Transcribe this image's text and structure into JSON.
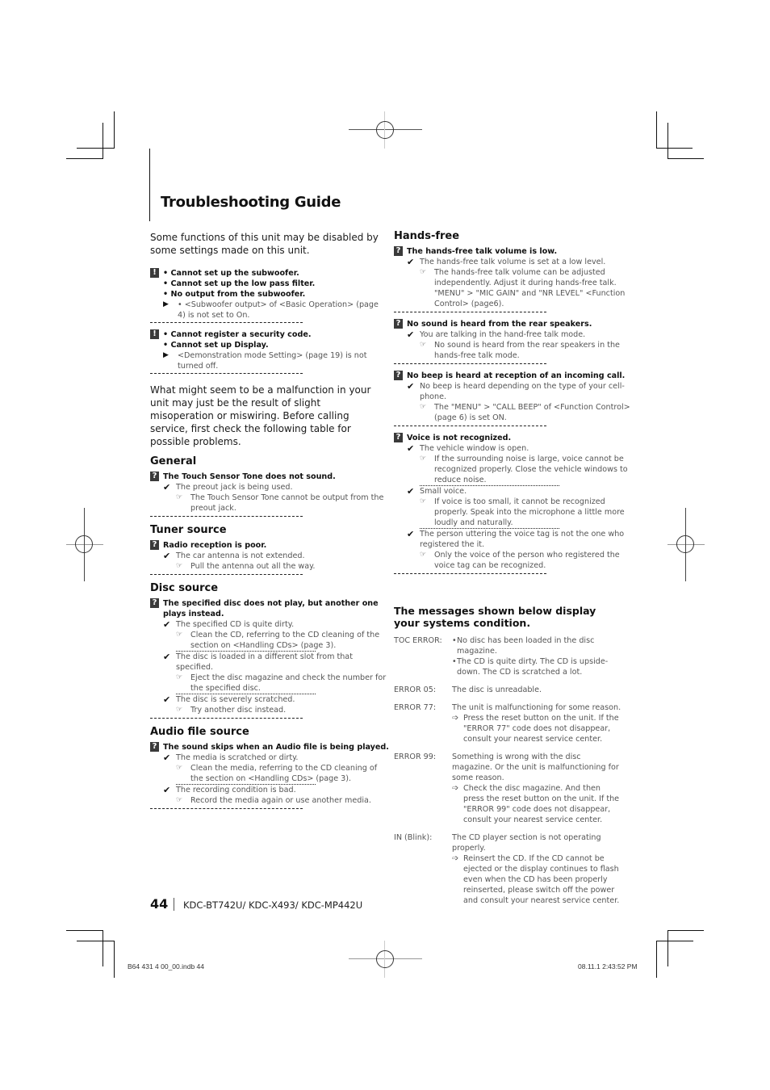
{
  "page": {
    "title": "Troubleshooting Guide",
    "page_number": "44",
    "model_line": "KDC-BT742U/ KDC-X493/ KDC-MP442U",
    "slug_file": "B64 431 4 00_00.indb   44",
    "slug_datetime": "08.11.1   2:43:52 PM"
  },
  "intro": "Some functions of this unit may be disabled by some settings made on this unit.",
  "notices": [
    {
      "icon": "exclamation-icon",
      "lines": [
        "• Cannot set up the subwoofer.",
        "• Cannot set up the low pass filter.",
        "• No output from the subwoofer."
      ],
      "note": "• <Subwoofer output> of <Basic Operation> (page 4) is not set to On."
    },
    {
      "icon": "exclamation-icon",
      "lines": [
        "• Cannot register a security code.",
        "• Cannot set up Display."
      ],
      "note": "<Demonstration mode Setting> (page 19) is not turned off."
    }
  ],
  "intro2": "What might seem to be a malfunction in your unit may just be the result of slight misoperation or miswiring. Before calling service, first check the following table for possible problems.",
  "sections_left": [
    {
      "heading": "General",
      "problems": [
        {
          "title": "The Touch Sensor Tone does not sound.",
          "causes": [
            {
              "cause": "The preout jack is being used.",
              "remedy": "The Touch Sensor Tone cannot be output from the preout jack."
            }
          ]
        }
      ]
    },
    {
      "heading": "Tuner source",
      "problems": [
        {
          "title": "Radio reception is poor.",
          "causes": [
            {
              "cause": "The car antenna is not extended.",
              "remedy": "Pull the antenna out all the way."
            }
          ]
        }
      ]
    },
    {
      "heading": "Disc source",
      "problems": [
        {
          "title": "The specified disc does not play, but another one plays instead.",
          "causes": [
            {
              "cause": "The specified CD is quite dirty.",
              "remedy": "Clean the CD, referring to the CD cleaning of the section on <Handling CDs> (page 3)."
            },
            {
              "cause": "The disc is loaded in a different slot from that specified.",
              "remedy": "Eject the disc magazine and check the number for the specified disc."
            },
            {
              "cause": "The disc is severely scratched.",
              "remedy": "Try another disc instead."
            }
          ]
        }
      ]
    },
    {
      "heading": "Audio file source",
      "problems": [
        {
          "title": "The sound skips when an Audio file is being played.",
          "causes": [
            {
              "cause": "The media is scratched or dirty.",
              "remedy": "Clean the media, referring to the CD cleaning of the section on <Handling CDs> (page 3)."
            },
            {
              "cause": "The recording condition is bad.",
              "remedy": "Record the media again or use another media."
            }
          ]
        }
      ]
    }
  ],
  "sections_right": [
    {
      "heading": "Hands-free",
      "problems": [
        {
          "title": "The hands-free talk volume is low.",
          "causes": [
            {
              "cause": "The hands-free talk volume is set at a low level.",
              "remedy": "The hands-free talk volume can be adjusted independently. Adjust it during hands-free talk. \"MENU\" > \"MIC GAIN\" and \"NR LEVEL\" <Function Control> (page6)."
            }
          ]
        },
        {
          "title": "No sound is heard from the rear speakers.",
          "causes": [
            {
              "cause": "You are talking in the hand-free talk mode.",
              "remedy": "No sound is heard from the rear speakers in the hands-free talk mode."
            }
          ]
        },
        {
          "title": "No beep is heard at reception of an incoming call.",
          "causes": [
            {
              "cause": "No beep is heard depending on the type of your cell-phone.",
              "remedy": "The \"MENU\" > \"CALL BEEP\" of <Function Control> (page 6) is set ON."
            }
          ]
        },
        {
          "title": "Voice is not recognized.",
          "causes": [
            {
              "cause": "The vehicle window is open.",
              "remedy": "If the surrounding noise is large, voice cannot be recognized properly. Close the vehicle windows to reduce noise."
            },
            {
              "cause": "Small voice.",
              "remedy": "If voice is too small, it cannot be recognized properly. Speak into the microphone a little more loudly and naturally."
            },
            {
              "cause": "The person uttering the voice tag is not the one who registered the it.",
              "remedy": "Only the voice of the person who registered the voice tag can be recognized."
            }
          ]
        }
      ]
    }
  ],
  "messages": {
    "heading": "The messages shown below display your systems condition.",
    "rows": [
      {
        "code": "TOC ERROR:",
        "bullets": [
          "No disc has been loaded in the disc magazine.",
          "The CD is quite dirty. The CD is upside-down. The CD is scratched a lot."
        ],
        "desc": "",
        "remedy": ""
      },
      {
        "code": "ERROR 05:",
        "bullets": [],
        "desc": "The disc is unreadable.",
        "remedy": ""
      },
      {
        "code": "ERROR 77:",
        "bullets": [],
        "desc": "The unit is malfunctioning for some reason.",
        "remedy": "Press the reset button on the unit. If the \"ERROR 77\" code does not disappear, consult your nearest service center."
      },
      {
        "code": "ERROR 99:",
        "bullets": [],
        "desc": "Something is wrong with the disc magazine. Or the unit is malfunctioning for some reason.",
        "remedy": "Check the disc magazine. And then press the reset button on the unit. If the \"ERROR 99\" code does not disappear, consult your nearest service center."
      },
      {
        "code": "IN (Blink):",
        "bullets": [],
        "desc": "The CD player section is not operating properly.",
        "remedy": "Reinsert the CD. If the CD cannot be ejected or the display continues to flash even when the CD has been properly reinserted, please switch off the power and consult your nearest service center."
      }
    ]
  },
  "icons": {
    "question": "?",
    "exclamation": "!",
    "check": "✔",
    "hand": "☞",
    "triangle": "▶",
    "arrow": "➩"
  }
}
